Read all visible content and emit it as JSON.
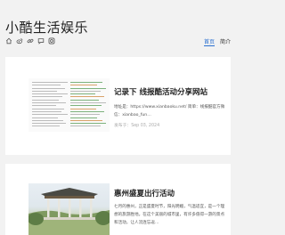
{
  "site": {
    "title": "小酷生活娱乐"
  },
  "social_icons": [
    "home-icon",
    "weibo-icon",
    "link-icon",
    "chat-icon",
    "camera-icon"
  ],
  "nav": {
    "items": [
      {
        "label": "首页",
        "active": true
      },
      {
        "label": "简介",
        "active": false
      }
    ]
  },
  "posts": [
    {
      "title": "记录下 线报酷活动分享网站",
      "excerpt": "地址是：https://www.xianbaoku.net/ 简单：线报酷官方微信：xianbao_fun…",
      "date": "发布于：Sep 03, 2024"
    },
    {
      "title": "惠州盛夏出行活动",
      "excerpt": "七月的惠州，正是盛夏时节，阳光明媚，气温适宜，是一个理想的旅游胜地。在这个美丽的城市里，有许多值得一游的景点和活动，让人流连忘返…"
    }
  ],
  "colors": {
    "accent": "#2a6fd0",
    "background": "#f2f2f2"
  }
}
